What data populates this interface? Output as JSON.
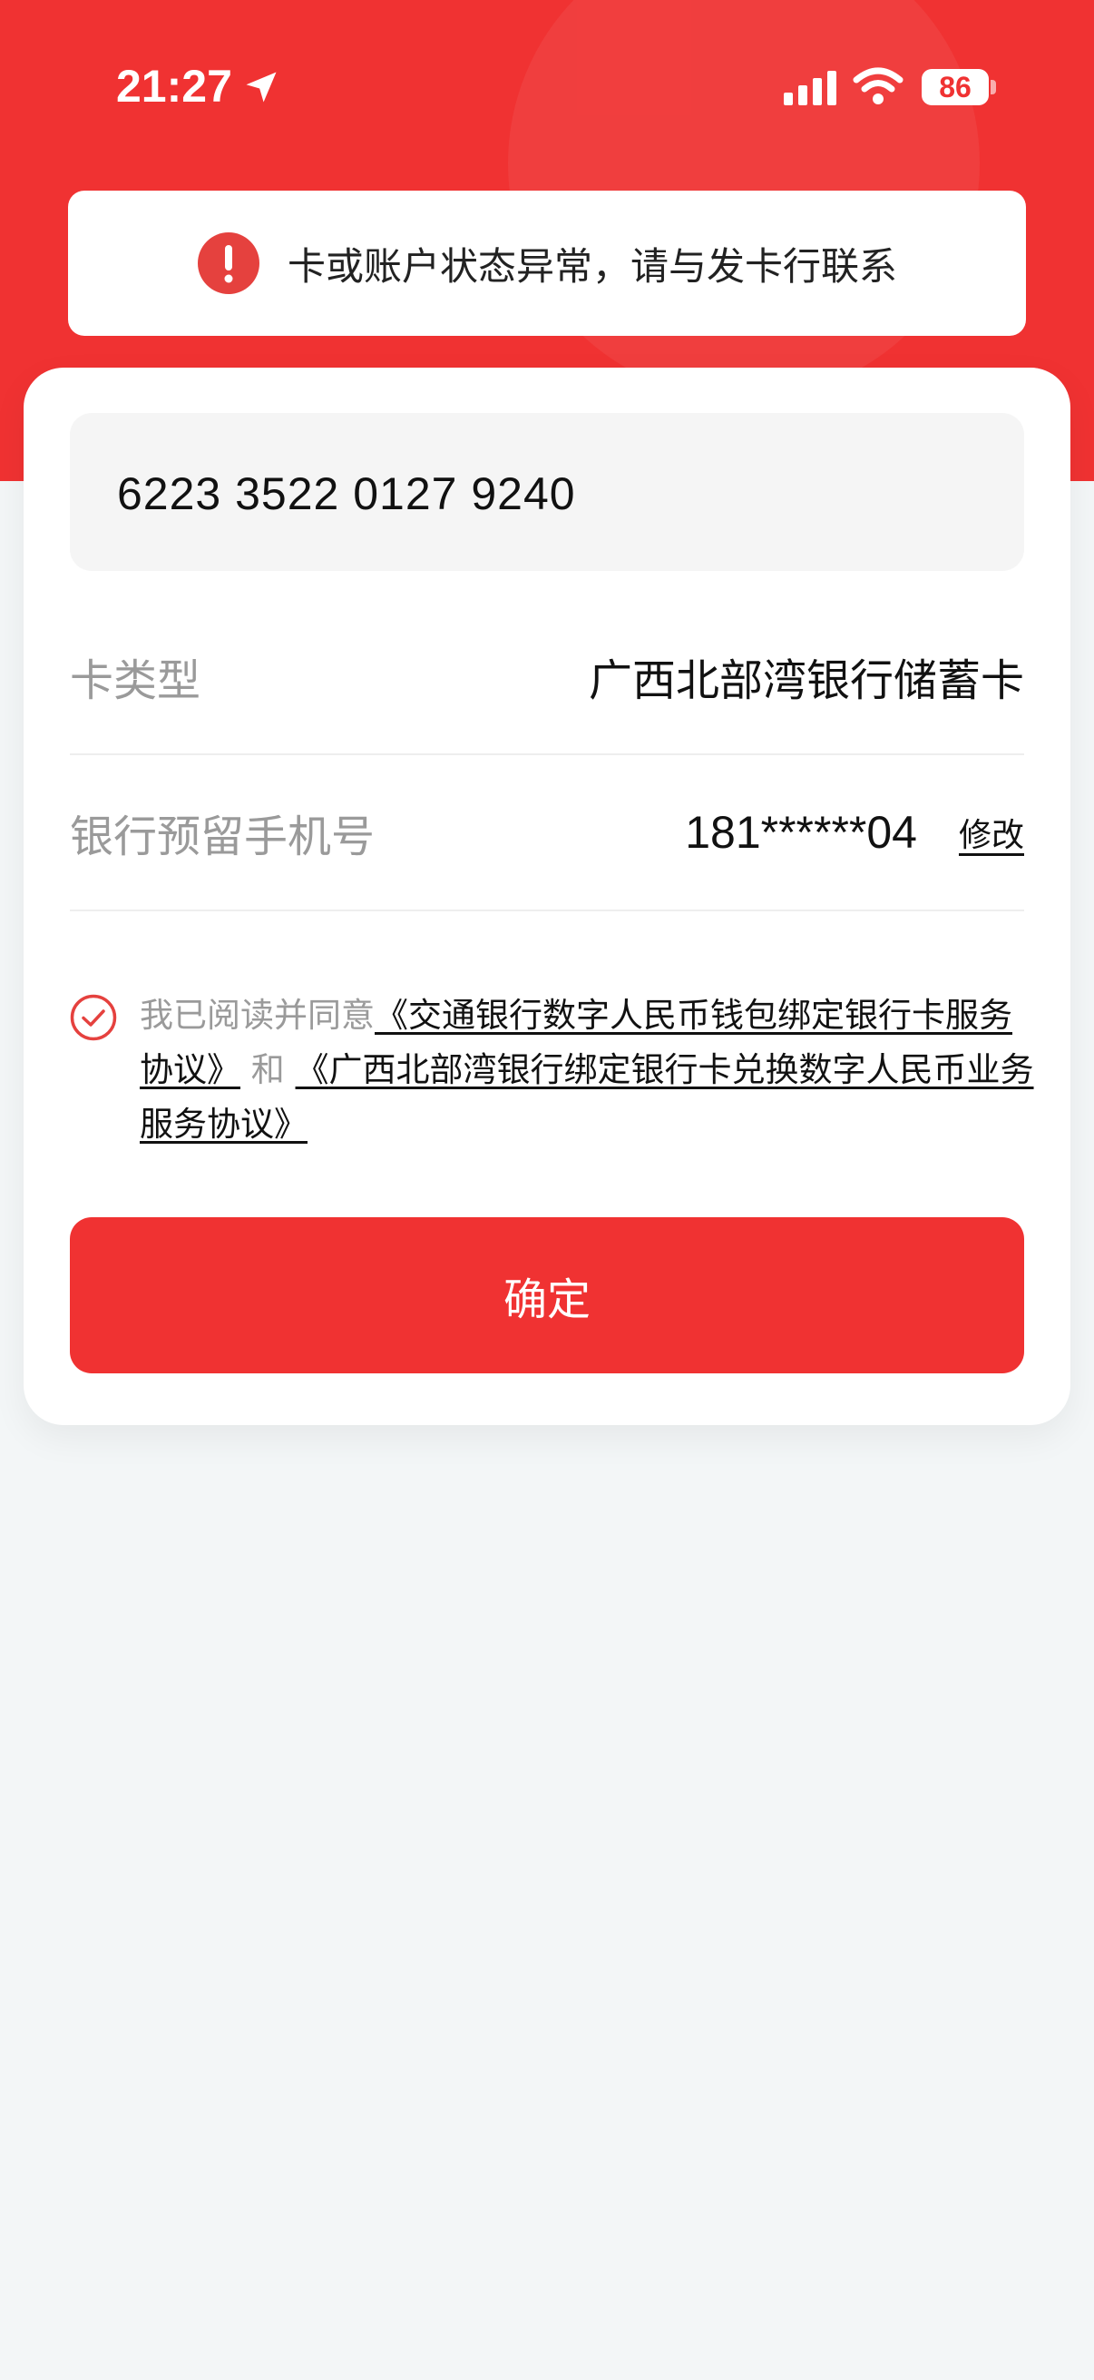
{
  "status_bar": {
    "time": "21:27",
    "battery": "86",
    "icons": [
      "location-arrow-icon",
      "cellular-signal-icon",
      "wifi-icon",
      "battery-icon"
    ]
  },
  "alert": {
    "icon": "exclamation-circle-icon",
    "text": "卡或账户状态异常，请与发卡行联系"
  },
  "form": {
    "card_number": "6223 3522 0127 9240",
    "card_type_label": "卡类型",
    "card_type_value": "广西北部湾银行储蓄卡",
    "phone_label": "银行预留手机号",
    "phone_value": "181******04",
    "edit_label": "修改"
  },
  "agreement": {
    "checked": true,
    "prefix": "我已阅读并同意",
    "open1": "《",
    "link1": "交通银行数字人民币钱包绑定银行卡服务协议",
    "close1": "》",
    "joiner": "和",
    "open2": "《",
    "link2": "广西北部湾银行绑定银行卡兑换数字人民币业务服务协议",
    "close2": "》"
  },
  "actions": {
    "confirm_label": "确定"
  },
  "colors": {
    "brand_red": "#f03232",
    "page_background": "#f3f6f7"
  }
}
